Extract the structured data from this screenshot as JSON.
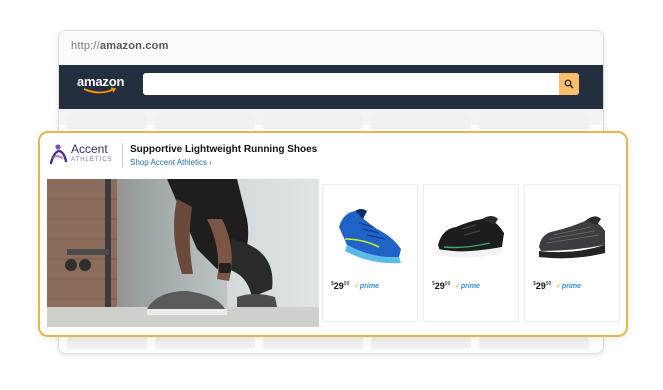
{
  "browser": {
    "url_protocol": "http://",
    "url_host": "amazon.com",
    "logo_text": "amazon",
    "search_placeholder": ""
  },
  "ad": {
    "brand": {
      "name": "Accent",
      "sub": "ATHLETICS"
    },
    "headline": "Supportive Lightweight Running Shoes",
    "shop_link": "Shop Accent Athletics ›",
    "products": [
      {
        "currency": "$",
        "whole": "29",
        "cents": "99",
        "prime_label": "prime",
        "prime_check": "✓",
        "shoe_color": "blue"
      },
      {
        "currency": "$",
        "whole": "29",
        "cents": "99",
        "prime_label": "prime",
        "prime_check": "✓",
        "shoe_color": "black"
      },
      {
        "currency": "$",
        "whole": "29",
        "cents": "99",
        "prime_label": "prime",
        "prime_check": "✓",
        "shoe_color": "dark-gray"
      }
    ]
  },
  "colors": {
    "navbar": "#232f3e",
    "search_button": "#febd69",
    "ad_border": "#eab54e",
    "link": "#1f6f9f",
    "prime": "#2f8fd8"
  }
}
